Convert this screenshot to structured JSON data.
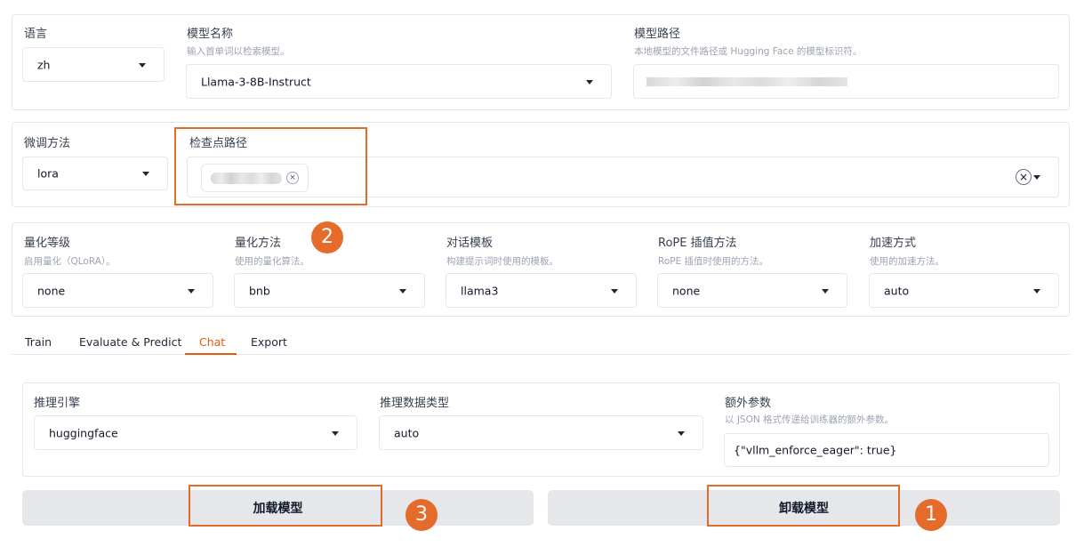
{
  "row1": {
    "language": {
      "label": "语言",
      "value": "zh"
    },
    "model_name": {
      "label": "模型名称",
      "hint": "输入首单词以检索模型。",
      "value": "Llama-3-8B-Instruct"
    },
    "model_path": {
      "label": "模型路径",
      "hint": "本地模型的文件路径或 Hugging Face 的模型标识符。"
    }
  },
  "row2": {
    "finetuning_type": {
      "label": "微调方法",
      "value": "lora"
    },
    "checkpoint_path": {
      "label": "检查点路径",
      "clear_symbol": "×"
    }
  },
  "row3": {
    "quantization_bit": {
      "label": "量化等级",
      "hint": "启用量化（QLoRA）。",
      "value": "none"
    },
    "quantization_method": {
      "label": "量化方法",
      "hint": "使用的量化算法。",
      "value": "bnb"
    },
    "template": {
      "label": "对话模板",
      "hint": "构建提示词时使用的模板。",
      "value": "llama3"
    },
    "rope_scaling": {
      "label": "RoPE 插值方法",
      "hint": "RoPE 插值时使用的方法。",
      "value": "none"
    },
    "booster": {
      "label": "加速方式",
      "hint": "使用的加速方法。",
      "value": "auto"
    }
  },
  "tabs": [
    {
      "label": "Train"
    },
    {
      "label": "Evaluate & Predict"
    },
    {
      "label": "Chat"
    },
    {
      "label": "Export"
    }
  ],
  "active_tab": "Chat",
  "chat": {
    "infer_backend": {
      "label": "推理引擎",
      "value": "huggingface"
    },
    "infer_dtype": {
      "label": "推理数据类型",
      "value": "auto"
    },
    "extra_args": {
      "label": "额外参数",
      "hint": "以 JSON 格式传递给训练器的额外参数。",
      "value": "{\"vllm_enforce_eager\": true}"
    }
  },
  "buttons": {
    "load": "加载模型",
    "unload": "卸载模型"
  },
  "annotations": {
    "badge1": "1",
    "badge2": "2",
    "badge3": "3"
  },
  "colors": {
    "accent": "#e46b2a",
    "active_tab": "#ea580c"
  }
}
